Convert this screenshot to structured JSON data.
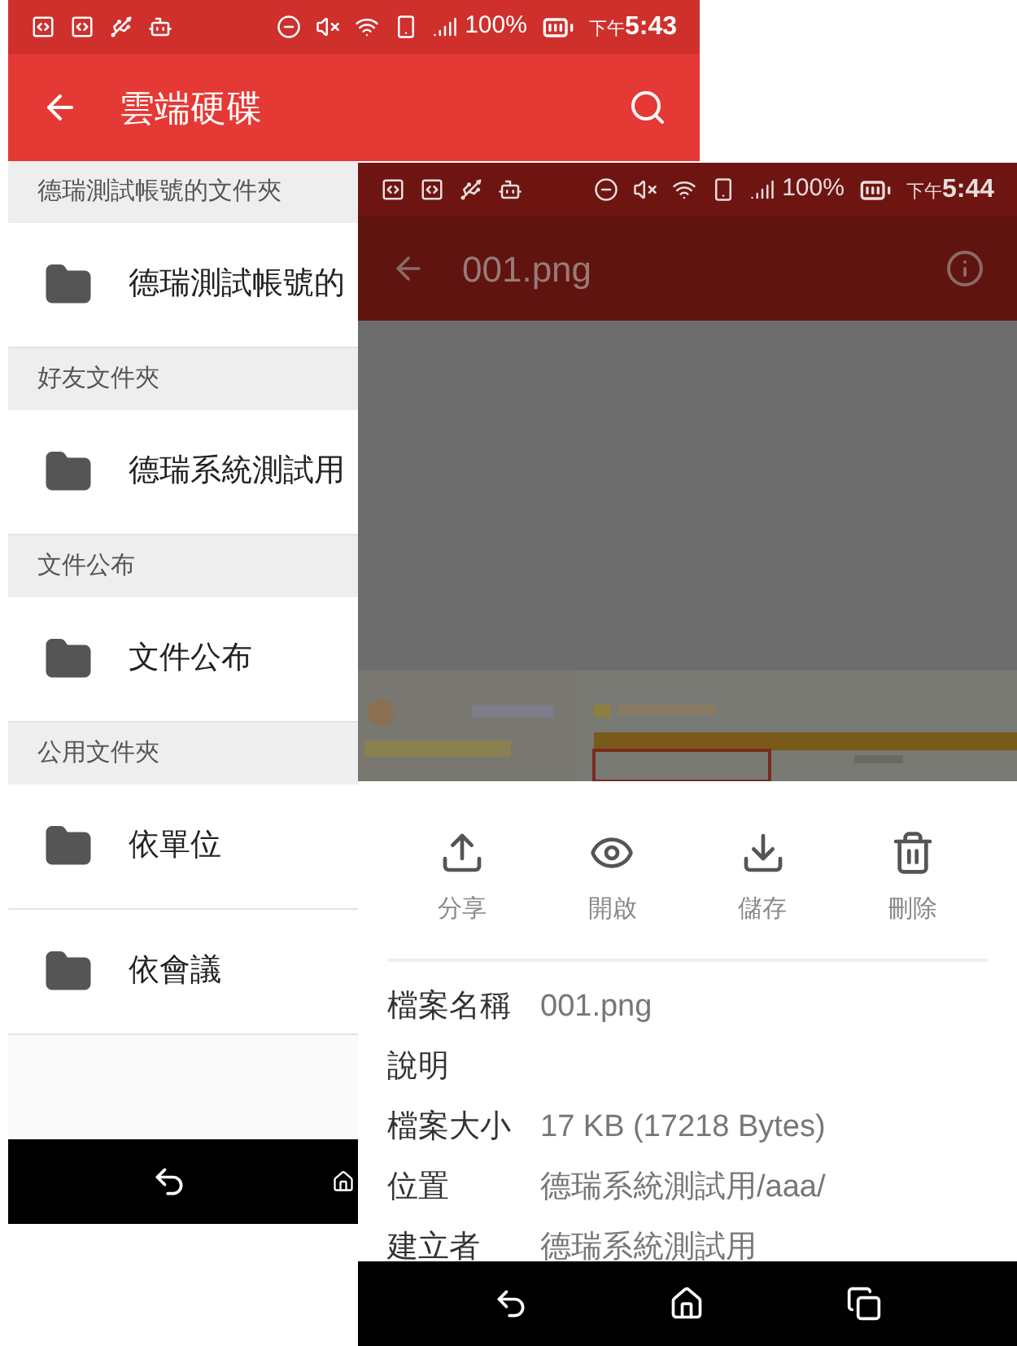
{
  "back_window": {
    "status_bar": {
      "battery": "100%",
      "time_prefix": "下午",
      "time": "5:43"
    },
    "app_bar": {
      "title": "雲端硬碟"
    },
    "sections": [
      {
        "header": "德瑞測試帳號的文件夾",
        "items": [
          {
            "label": "德瑞測試帳號的"
          }
        ]
      },
      {
        "header": "好友文件夾",
        "items": [
          {
            "label": "德瑞系統測試用"
          }
        ]
      },
      {
        "header": "文件公布",
        "items": [
          {
            "label": "文件公布"
          }
        ]
      },
      {
        "header": "公用文件夾",
        "items": [
          {
            "label": "依單位"
          },
          {
            "label": "依會議"
          }
        ]
      }
    ]
  },
  "front_window": {
    "status_bar": {
      "battery": "100%",
      "time_prefix": "下午",
      "time": "5:44"
    },
    "toolbar": {
      "title": "001.png"
    },
    "actions": [
      {
        "kind": "share",
        "label": "分享"
      },
      {
        "kind": "open",
        "label": "開啟"
      },
      {
        "kind": "save",
        "label": "儲存"
      },
      {
        "kind": "delete",
        "label": "刪除"
      }
    ],
    "details": [
      {
        "label": "檔案名稱",
        "value": "001.png"
      },
      {
        "label": "說明"
      },
      {
        "label": "檔案大小",
        "value": "17 KB (17218 Bytes)"
      },
      {
        "label": "位置",
        "value": "德瑞系統測試用/aaa/"
      },
      {
        "label": "建立者",
        "value": "德瑞系統測試用"
      }
    ]
  }
}
